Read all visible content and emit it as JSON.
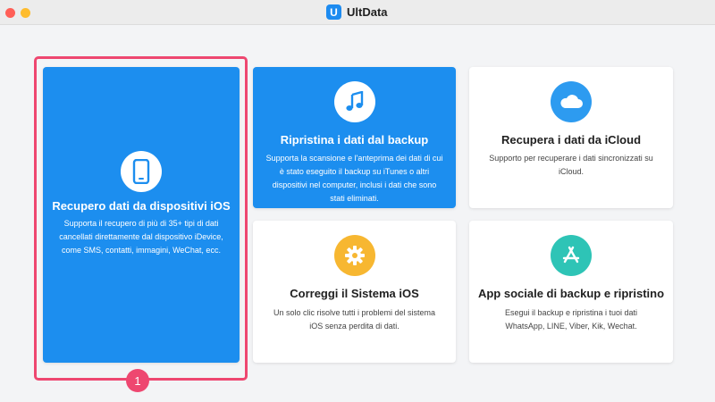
{
  "window": {
    "title": "UltData",
    "logo_letter": "U"
  },
  "cards": [
    {
      "title": "Recupero dati da dispositivi iOS",
      "description": "Supporta il recupero di più di 35+ tipi di dati cancellati direttamente dal dispositivo iDevice, come SMS, contatti, immagini, WeChat, ecc.",
      "icon": "phone-icon",
      "selected": true
    },
    {
      "title": "Ripristina i dati dal backup",
      "description": "Supporta la scansione e l'anteprima dei dati di cui è stato eseguito il backup su iTunes o altri dispositivi nel computer, inclusi i dati che sono stati eliminati.",
      "icon": "music-note-icon"
    },
    {
      "title": "Recupera i dati da iCloud",
      "description": "Supporto per recuperare i dati sincronizzati su iCloud.",
      "icon": "cloud-icon"
    },
    {
      "title": "Correggi il Sistema iOS",
      "description": "Un solo clic risolve tutti i problemi del sistema iOS senza perdita di dati.",
      "icon": "gear-icon"
    },
    {
      "title": "App sociale di backup e ripristino",
      "description": "Esegui il backup e ripristina i tuoi dati WhatsApp, LINE, Viber, Kik, Wechat.",
      "icon": "app-store-icon"
    }
  ],
  "annotation": {
    "step_number": "1"
  },
  "colors": {
    "primary_blue": "#1c8eef",
    "highlight_pink": "#ee4770",
    "cloud_blue": "#2d9bf0",
    "gear_yellow": "#f7b731",
    "appstore_teal": "#2ec4b6"
  }
}
